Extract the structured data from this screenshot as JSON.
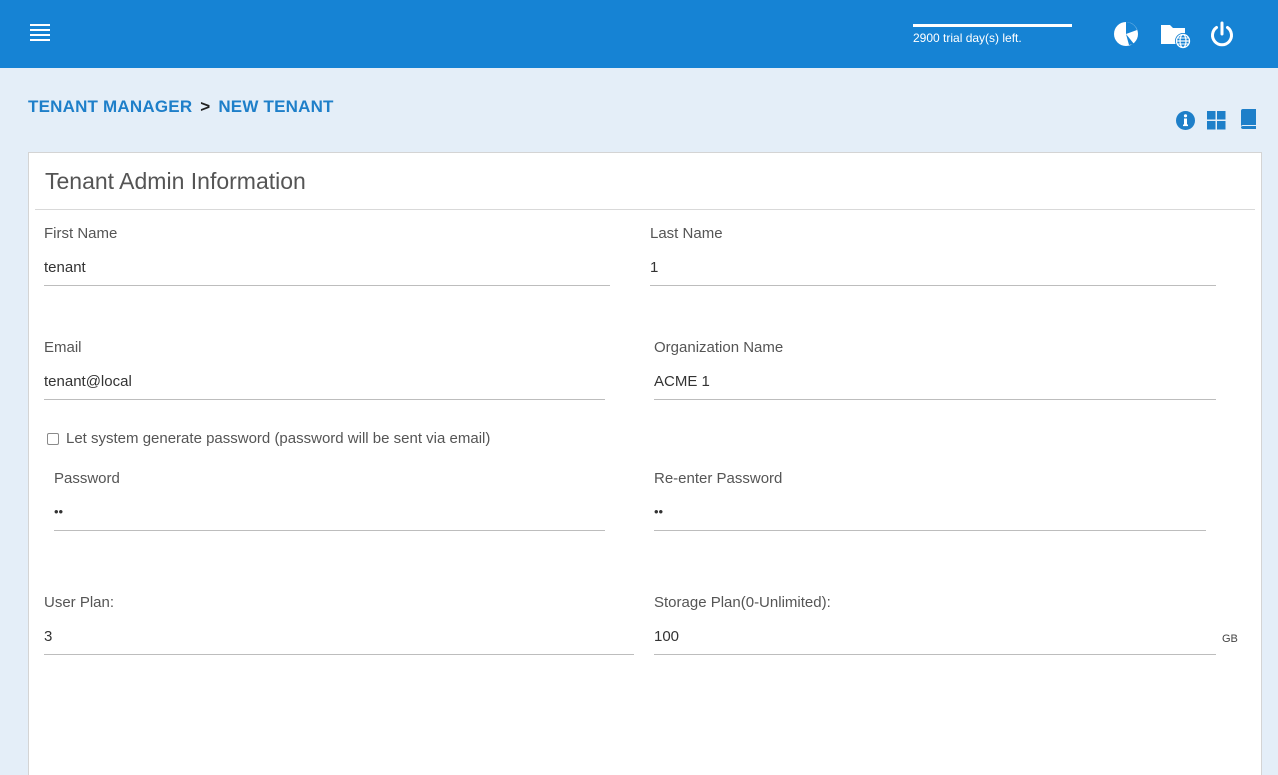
{
  "header": {
    "trial_text": "2900 trial day(s) left.",
    "trial_progress": 1.0,
    "icons": [
      "menu-icon",
      "dashboard-pie-icon",
      "cloud-folder-icon",
      "power-icon"
    ]
  },
  "breadcrumb": {
    "root": "TENANT MANAGER",
    "separator": ">",
    "current": "NEW TENANT"
  },
  "toolbar_icons": [
    "info-icon",
    "grid-icon",
    "book-icon"
  ],
  "form": {
    "title": "Tenant Admin Information",
    "first_name": {
      "label": "First Name",
      "value": "tenant"
    },
    "last_name": {
      "label": "Last Name",
      "value": "1"
    },
    "email": {
      "label": "Email",
      "value": "tenant@local"
    },
    "organization": {
      "label": "Organization Name",
      "value": "ACME 1"
    },
    "generate_password": {
      "label": "Let system generate password (password will be sent via email)",
      "checked": false
    },
    "password": {
      "label": "Password",
      "value": "••"
    },
    "reenter_password": {
      "label": "Re-enter Password",
      "value": "••"
    },
    "user_plan": {
      "label": "User Plan:",
      "value": "3"
    },
    "storage_plan": {
      "label": "Storage Plan(0-Unlimited):",
      "value": "100",
      "unit": "GB"
    }
  },
  "colors": {
    "accent": "#1683d4",
    "link": "#1e7fc9",
    "background": "#e4eef8"
  }
}
